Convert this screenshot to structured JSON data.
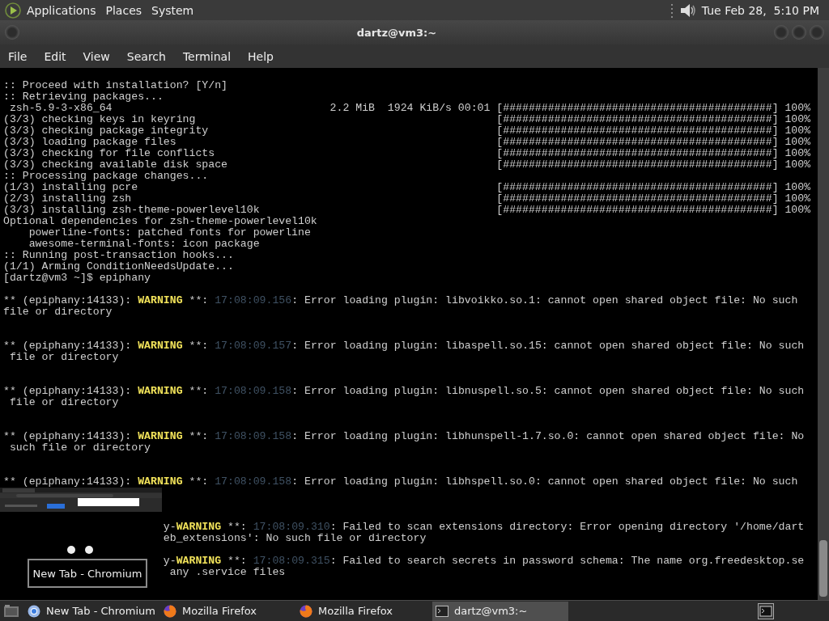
{
  "top_panel": {
    "menus": [
      "Applications",
      "Places",
      "System"
    ],
    "clock": "Tue Feb 28,  5:10 PM"
  },
  "window": {
    "title": "dartz@vm3:~",
    "menu": [
      "File",
      "Edit",
      "View",
      "Search",
      "Terminal",
      "Help"
    ]
  },
  "terminal": {
    "lines": [
      {
        "kind": "text",
        "text": ":: Proceed with installation? [Y/n]"
      },
      {
        "kind": "text",
        "text": ":: Retrieving packages..."
      },
      {
        "kind": "progress",
        "label": " zsh-5.9-3-x86_64",
        "stats": "2.2 MiB  1924 KiB/s 00:01",
        "bar": "[##########################################]",
        "percent": "100%"
      },
      {
        "kind": "progress",
        "label": "(3/3) checking keys in keyring",
        "bar": "[##########################################]",
        "percent": "100%"
      },
      {
        "kind": "progress",
        "label": "(3/3) checking package integrity",
        "bar": "[##########################################]",
        "percent": "100%"
      },
      {
        "kind": "progress",
        "label": "(3/3) loading package files",
        "bar": "[##########################################]",
        "percent": "100%"
      },
      {
        "kind": "progress",
        "label": "(3/3) checking for file conflicts",
        "bar": "[##########################################]",
        "percent": "100%"
      },
      {
        "kind": "progress",
        "label": "(3/3) checking available disk space",
        "bar": "[##########################################]",
        "percent": "100%"
      },
      {
        "kind": "text",
        "text": ":: Processing package changes..."
      },
      {
        "kind": "progress",
        "label": "(1/3) installing pcre",
        "bar": "[##########################################]",
        "percent": "100%"
      },
      {
        "kind": "progress",
        "label": "(2/3) installing zsh",
        "bar": "[##########################################]",
        "percent": "100%"
      },
      {
        "kind": "progress",
        "label": "(3/3) installing zsh-theme-powerlevel10k",
        "bar": "[##########################################]",
        "percent": "100%"
      },
      {
        "kind": "text",
        "text": "Optional dependencies for zsh-theme-powerlevel10k"
      },
      {
        "kind": "text",
        "text": "    powerline-fonts: patched fonts for powerline"
      },
      {
        "kind": "text",
        "text": "    awesome-terminal-fonts: icon package"
      },
      {
        "kind": "text",
        "text": ":: Running post-transaction hooks..."
      },
      {
        "kind": "text",
        "text": "(1/1) Arming ConditionNeedsUpdate..."
      },
      {
        "kind": "text",
        "text": "[dartz@vm3 ~]$ epiphany"
      },
      {
        "kind": "blank"
      },
      {
        "kind": "log",
        "segments": [
          {
            "kind": "plain",
            "text": "** (epiphany:14133): "
          },
          {
            "kind": "warning",
            "text": "WARNING"
          },
          {
            "kind": "plain",
            "text": " **: "
          },
          {
            "kind": "time",
            "text": "17:08:09.156"
          },
          {
            "kind": "plain",
            "text": ": Error loading plugin: libvoikko.so.1: cannot open shared object file: No such"
          }
        ]
      },
      {
        "kind": "text",
        "text": "file or directory"
      },
      {
        "kind": "blank"
      },
      {
        "kind": "blank"
      },
      {
        "kind": "log",
        "segments": [
          {
            "kind": "plain",
            "text": "** (epiphany:14133): "
          },
          {
            "kind": "warning",
            "text": "WARNING"
          },
          {
            "kind": "plain",
            "text": " **: "
          },
          {
            "kind": "time",
            "text": "17:08:09.157"
          },
          {
            "kind": "plain",
            "text": ": Error loading plugin: libaspell.so.15: cannot open shared object file: No such"
          }
        ]
      },
      {
        "kind": "text",
        "text": " file or directory"
      },
      {
        "kind": "blank"
      },
      {
        "kind": "blank"
      },
      {
        "kind": "log",
        "segments": [
          {
            "kind": "plain",
            "text": "** (epiphany:14133): "
          },
          {
            "kind": "warning",
            "text": "WARNING"
          },
          {
            "kind": "plain",
            "text": " **: "
          },
          {
            "kind": "time",
            "text": "17:08:09.158"
          },
          {
            "kind": "plain",
            "text": ": Error loading plugin: libnuspell.so.5: cannot open shared object file: No such"
          }
        ]
      },
      {
        "kind": "text",
        "text": " file or directory"
      },
      {
        "kind": "blank"
      },
      {
        "kind": "blank"
      },
      {
        "kind": "log",
        "segments": [
          {
            "kind": "plain",
            "text": "** (epiphany:14133): "
          },
          {
            "kind": "warning",
            "text": "WARNING"
          },
          {
            "kind": "plain",
            "text": " **: "
          },
          {
            "kind": "time",
            "text": "17:08:09.158"
          },
          {
            "kind": "plain",
            "text": ": Error loading plugin: libhunspell-1.7.so.0: cannot open shared object file: No"
          }
        ]
      },
      {
        "kind": "text",
        "text": " such file or directory"
      },
      {
        "kind": "blank"
      },
      {
        "kind": "blank"
      },
      {
        "kind": "log",
        "segments": [
          {
            "kind": "plain",
            "text": "** (epiphany:14133): "
          },
          {
            "kind": "warning",
            "text": "WARNING"
          },
          {
            "kind": "plain",
            "text": " **: "
          },
          {
            "kind": "time",
            "text": "17:08:09.158"
          },
          {
            "kind": "plain",
            "text": ": Error loading plugin: libhspell.so.0: cannot open shared object file: No such"
          }
        ]
      },
      {
        "kind": "blank"
      },
      {
        "kind": "blank"
      },
      {
        "kind": "blank"
      },
      {
        "kind": "tail",
        "segments": [
          {
            "kind": "plain",
            "text": "y-"
          },
          {
            "kind": "warning",
            "text": "WARNING"
          },
          {
            "kind": "plain",
            "text": " **: "
          },
          {
            "kind": "time",
            "text": "17:08:09.310"
          },
          {
            "kind": "plain",
            "text": ": Failed to scan extensions directory: Error opening directory '/home/dart"
          }
        ]
      },
      {
        "kind": "tail",
        "segments": [
          {
            "kind": "plain",
            "text": "eb_extensions': No such file or directory"
          }
        ]
      },
      {
        "kind": "blank"
      },
      {
        "kind": "tail",
        "segments": [
          {
            "kind": "plain",
            "text": "y-"
          },
          {
            "kind": "warning",
            "text": "WARNING"
          },
          {
            "kind": "plain",
            "text": " **: "
          },
          {
            "kind": "time",
            "text": "17:08:09.315"
          },
          {
            "kind": "plain",
            "text": ": Failed to search secrets in password schema: The name org.freedesktop.se"
          }
        ]
      },
      {
        "kind": "tail",
        "segments": [
          {
            "kind": "plain",
            "text": " any .service files"
          }
        ]
      }
    ]
  },
  "preview_popup": {
    "label": "New Tab - Chromium"
  },
  "taskbar": {
    "tasks": [
      {
        "kind": "chromium",
        "label": "New Tab - Chromium",
        "selected": false
      },
      {
        "kind": "firefox",
        "label": "Mozilla Firefox",
        "selected": false
      },
      {
        "kind": "firefox",
        "label": "Mozilla Firefox",
        "selected": false
      },
      {
        "kind": "terminal",
        "label": "dartz@vm3:~",
        "selected": true
      }
    ]
  }
}
